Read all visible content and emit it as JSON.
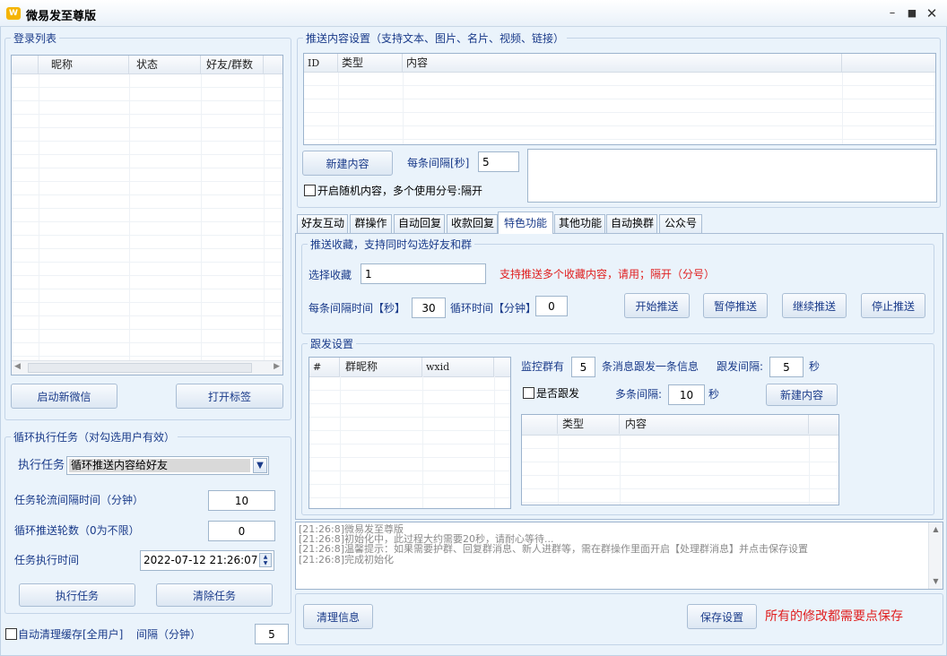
{
  "window": {
    "title": "微易发至尊版",
    "app_icon_text": "W"
  },
  "login_list": {
    "title": "登录列表",
    "columns": [
      "",
      "昵称",
      "状态",
      "好友/群数"
    ],
    "start_button": "启动新微信",
    "open_tag_button": "打开标签"
  },
  "cycle_task": {
    "title": "循环执行任务（对勾选用户有效）",
    "task_label": "执行任务",
    "task_value": "循环推送内容给好友",
    "interval_label": "任务轮流间隔时间（分钟）",
    "interval_value": "10",
    "rounds_label": "循环推送轮数（0为不限）",
    "rounds_value": "0",
    "exec_time_label": "任务执行时间",
    "exec_time_value": "2022-07-12 21:26:07",
    "run_button": "执行任务",
    "clear_button": "清除任务"
  },
  "auto_clean": {
    "label": "自动清理缓存[全用户]",
    "interval_label": "间隔（分钟）",
    "interval_value": "5"
  },
  "push_content": {
    "title": "推送内容设置（支持文本、图片、名片、视频、链接）",
    "columns": [
      "ID",
      "类型",
      "内容",
      ""
    ],
    "new_button": "新建内容",
    "interval_label": "每条间隔[秒]",
    "interval_value": "5",
    "random_label": "开启随机内容，多个使用分号:隔开"
  },
  "tabs": [
    "好友互动",
    "群操作",
    "自动回复",
    "收款回复",
    "特色功能",
    "其他功能",
    "自动换群",
    "公众号"
  ],
  "active_tab": 4,
  "push_favorites": {
    "title": "推送收藏，支持同时勾选好友和群",
    "select_label": "选择收藏",
    "select_value": "1",
    "hint": "支持推送多个收藏内容，请用；隔开（分号）",
    "interval_label": "每条间隔时间【秒】",
    "interval_value": "30",
    "cycle_label": "循环时间【分钟】",
    "cycle_value": "0",
    "start_button": "开始推送",
    "pause_button": "暂停推送",
    "continue_button": "继续推送",
    "stop_button": "停止推送"
  },
  "follow": {
    "title": "跟发设置",
    "group_columns": [
      "#",
      "群昵称",
      "wxid",
      ""
    ],
    "monitor_label": "监控群有",
    "monitor_value": "5",
    "monitor_suffix": "条消息跟发一条信息",
    "follow_interval_label": "跟发间隔:",
    "follow_interval_value": "5",
    "seconds": "秒",
    "follow_check_label": "是否跟发",
    "multi_interval_label": "多条间隔:",
    "multi_interval_value": "10",
    "new_button": "新建内容",
    "content_columns": [
      "",
      "类型",
      "内容",
      ""
    ]
  },
  "log": [
    "[21:26:8]微易发至尊版",
    "[21:26:8]初始化中，此过程大约需要20秒，请耐心等待...",
    "[21:26:8]温馨提示：如果需要护群、回复群消息、新人进群等，需在群操作里面开启【处理群消息】并点击保存设置",
    "[21:26:8]完成初始化"
  ],
  "footer": {
    "clear_button": "清理信息",
    "save_button": "保存设置",
    "save_hint": "所有的修改都需要点保存"
  }
}
